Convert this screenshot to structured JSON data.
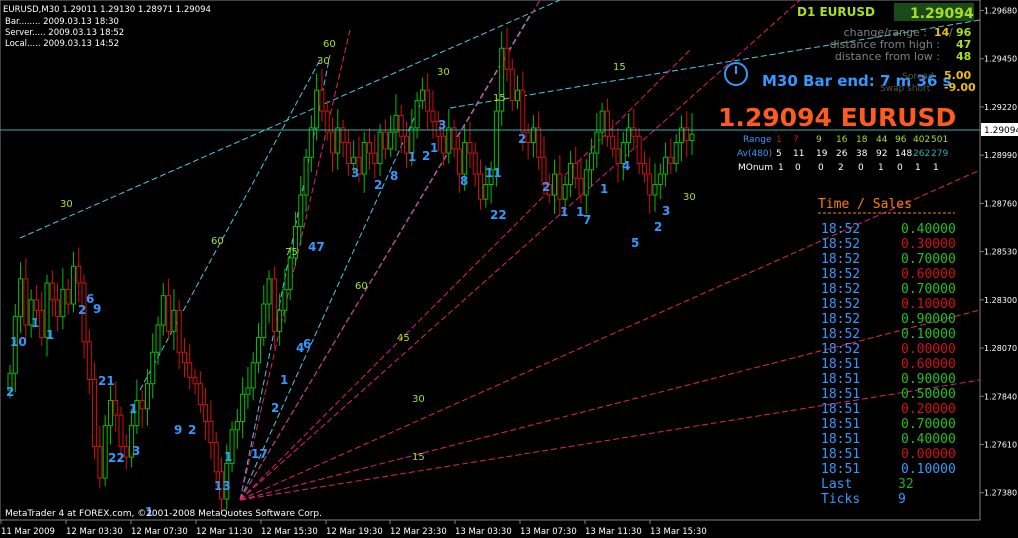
{
  "header": {
    "symbol_line": "EURUSD,M30  1.29011 1.29130 1.28971 1.29094",
    "bar": "Bar........ 2009.03.13 18:30",
    "server": "Server..... 2009.03.13 18:52",
    "local": "Local..... 2009.03.13 14:52"
  },
  "d1_panel": {
    "title": "D1 EURUSD",
    "price": "1.29094",
    "rows": [
      {
        "label": "change/range :",
        "value": "14",
        "value2": "96"
      },
      {
        "label": "distance from high :",
        "value": "47"
      },
      {
        "label": "distance from low :",
        "value": "48"
      }
    ]
  },
  "bar_end": {
    "label": "M30 Bar end: 7 m 36 s",
    "spread_label": "Spread",
    "spread": "5.00",
    "swap_label": "Swap short",
    "swap": "-9.00"
  },
  "big_price": "1.29094 EURUSD",
  "range_table": {
    "headers": [
      "Range",
      "Av(480)",
      "MOnum"
    ],
    "range": [
      "1",
      "7",
      "9",
      "16",
      "18",
      "44",
      "96",
      "402",
      "501"
    ],
    "av": [
      "5",
      "11",
      "19",
      "26",
      "38",
      "92",
      "148",
      "262",
      "279"
    ],
    "momentum": [
      "1",
      "0",
      "0",
      "2",
      "0",
      "1",
      "0",
      "1",
      "1"
    ]
  },
  "time_sales": {
    "title": "Time / Sales",
    "rows": [
      {
        "time": "18:52",
        "value": "0.40000",
        "dir": "up"
      },
      {
        "time": "18:52",
        "value": "0.30000",
        "dir": "down"
      },
      {
        "time": "18:52",
        "value": "0.70000",
        "dir": "up"
      },
      {
        "time": "18:52",
        "value": "0.60000",
        "dir": "down"
      },
      {
        "time": "18:52",
        "value": "0.70000",
        "dir": "up"
      },
      {
        "time": "18:52",
        "value": "0.10000",
        "dir": "down"
      },
      {
        "time": "18:52",
        "value": "0.90000",
        "dir": "up"
      },
      {
        "time": "18:52",
        "value": "0.10000",
        "dir": "up"
      },
      {
        "time": "18:52",
        "value": "0.00000",
        "dir": "down"
      },
      {
        "time": "18:51",
        "value": "0.60000",
        "dir": "down"
      },
      {
        "time": "18:51",
        "value": "0.90000",
        "dir": "up"
      },
      {
        "time": "18:51",
        "value": "0.50000",
        "dir": "up"
      },
      {
        "time": "18:51",
        "value": "0.20000",
        "dir": "down"
      },
      {
        "time": "18:51",
        "value": "0.70000",
        "dir": "up"
      },
      {
        "time": "18:51",
        "value": "0.40000",
        "dir": "up"
      },
      {
        "time": "18:51",
        "value": "0.00000",
        "dir": "down"
      },
      {
        "time": "18:51",
        "value": "0.10000",
        "dir": "neutral"
      }
    ],
    "last_label": "Last",
    "last": "32",
    "ticks_label": "Ticks",
    "ticks": "9"
  },
  "footer": "MetaTrader 4 at FOREX.com, ©2001-2008 MetaQuotes Software Corp.",
  "colors": {
    "background": "#000000",
    "bull": "#00c000",
    "bear": "#d01010",
    "wave": "#3399ff",
    "gann_cyan": "#4ac8e8",
    "gann_pink": "#e02070",
    "price_line": "#2fb4b4",
    "big_price": "#ff5a20",
    "yellow_green": "#a8e020"
  },
  "chart_data": {
    "type": "candlestick",
    "symbol": "EURUSD",
    "timeframe": "M30",
    "last_price": 1.29094,
    "ylim": [
      1.2725,
      1.2973
    ],
    "y_ticks": [
      "1.29680",
      "1.29450",
      "1.29220",
      "1.28990",
      "1.28760",
      "1.28530",
      "1.28300",
      "1.28070",
      "1.27840",
      "1.27610",
      "1.27380"
    ],
    "y_tick_values": [
      1.2968,
      1.2945,
      1.2922,
      1.2899,
      1.2876,
      1.2853,
      1.283,
      1.2807,
      1.2784,
      1.2761,
      1.2738
    ],
    "x_ticks": [
      "11 Mar 2009",
      "12 Mar 03:30",
      "12 Mar 07:30",
      "12 Mar 11:30",
      "12 Mar 15:30",
      "12 Mar 19:30",
      "12 Mar 23:30",
      "13 Mar 03:30",
      "13 Mar 07:30",
      "13 Mar 11:30",
      "13 Mar 15:30"
    ],
    "gann_labels_upper": [
      {
        "label": "60",
        "series": "cyan"
      },
      {
        "label": "30",
        "series": "cyan"
      },
      {
        "label": "30",
        "series": "cyan"
      },
      {
        "label": "30",
        "series": "cyan"
      },
      {
        "label": "15",
        "series": "cyan"
      },
      {
        "label": "15",
        "series": "cyan"
      },
      {
        "label": "60",
        "series": "cyan"
      },
      {
        "label": "75",
        "series": "cyan"
      },
      {
        "label": "30",
        "series": "pink"
      }
    ],
    "gann_labels_lower": [
      "60",
      "45",
      "30",
      "15"
    ],
    "wave_labels": [
      "2",
      "10",
      "1",
      "1",
      "2",
      "6",
      "9",
      "21",
      "22",
      "1",
      "3",
      "1",
      "9",
      "2",
      "13",
      "1",
      "17",
      "2",
      "1",
      "4",
      "6",
      "47",
      "3",
      "2",
      "8",
      "1",
      "2",
      "1",
      "3",
      "8",
      "11",
      "22",
      "2",
      "2",
      "1",
      "1",
      "7",
      "1",
      "4",
      "5",
      "3",
      "2"
    ],
    "closes": [
      1.2795,
      1.2822,
      1.284,
      1.2818,
      1.283,
      1.2825,
      1.2812,
      1.2838,
      1.283,
      1.2822,
      1.2835,
      1.2828,
      1.2846,
      1.2838,
      1.281,
      1.2792,
      1.276,
      1.2745,
      1.277,
      1.2782,
      1.2775,
      1.276,
      1.2755,
      1.277,
      1.2782,
      1.2778,
      1.279,
      1.2805,
      1.2818,
      1.2832,
      1.2815,
      1.2825,
      1.2805,
      1.28,
      1.2793,
      1.279,
      1.278,
      1.2772,
      1.2762,
      1.2748,
      1.2735,
      1.2752,
      1.2768,
      1.2772,
      1.2785,
      1.2788,
      1.28,
      1.2812,
      1.2828,
      1.284,
      1.2815,
      1.2825,
      1.2835,
      1.285,
      1.2865,
      1.288,
      1.2898,
      1.2912,
      1.293,
      1.292,
      1.291,
      1.29,
      1.2912,
      1.2905,
      1.2895,
      1.2898,
      1.289,
      1.2905,
      1.29,
      1.2895,
      1.291,
      1.2902,
      1.291,
      1.2918,
      1.2908,
      1.29,
      1.2912,
      1.2925,
      1.293,
      1.292,
      1.2915,
      1.2908,
      1.29,
      1.2912,
      1.2902,
      1.289,
      1.2905,
      1.29,
      1.289,
      1.2878,
      1.2885,
      1.2892,
      1.292,
      1.295,
      1.294,
      1.2925,
      1.293,
      1.291,
      1.2905,
      1.2912,
      1.2898,
      1.2885,
      1.288,
      1.289,
      1.2878,
      1.2885,
      1.2895,
      1.2888,
      1.288,
      1.2892,
      1.29,
      1.291,
      1.292,
      1.2908,
      1.2902,
      1.2895,
      1.2905,
      1.2912,
      1.2908,
      1.2895,
      1.289,
      1.288,
      1.2885,
      1.289,
      1.2898,
      1.2895,
      1.2905,
      1.2912,
      1.2906,
      1.2909
    ]
  }
}
